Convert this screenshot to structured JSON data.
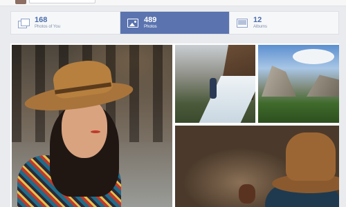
{
  "stats": [
    {
      "count": "168",
      "label": "Photos of You",
      "icon": "photos-of-you-icon",
      "active": false
    },
    {
      "count": "489",
      "label": "Photos",
      "icon": "photos-icon",
      "active": true
    },
    {
      "count": "12",
      "label": "Albums",
      "icon": "albums-icon",
      "active": false
    }
  ],
  "colors": {
    "active_tab": "#5b74b0",
    "link_blue": "#4a6cab",
    "page_bg": "#e9ebee"
  },
  "photos": [
    {
      "subject": "woman in tan fedora portrait"
    },
    {
      "subject": "hiker by waterfall"
    },
    {
      "subject": "mountain valley with clouds"
    },
    {
      "subject": "person in hat from behind"
    }
  ]
}
